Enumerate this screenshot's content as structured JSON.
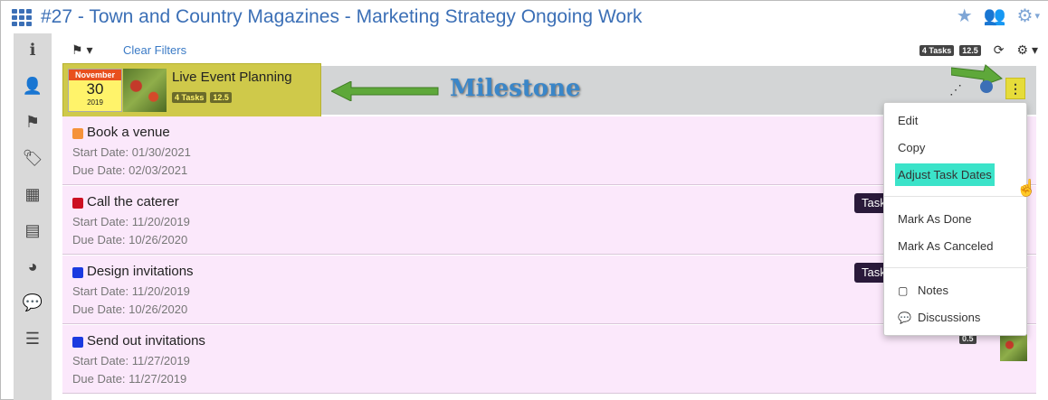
{
  "header": {
    "title": "#27 - Town and Country Magazines - Marketing Strategy Ongoing Work",
    "icons": [
      "apps-grid-icon",
      "star-icon",
      "users-icon",
      "gear-icon"
    ]
  },
  "sidebar": {
    "items": [
      {
        "name": "info-icon",
        "glyph": "ℹ"
      },
      {
        "name": "user-icon",
        "glyph": "👤"
      },
      {
        "name": "flag-icon",
        "glyph": "⚑"
      },
      {
        "name": "tags-icon",
        "glyph": "🏷"
      },
      {
        "name": "calendar-icon",
        "glyph": "▦"
      },
      {
        "name": "archive-icon",
        "glyph": "▤"
      },
      {
        "name": "pie-chart-icon",
        "glyph": "◕"
      },
      {
        "name": "comments-icon",
        "glyph": "💬"
      },
      {
        "name": "list-icon",
        "glyph": "☰"
      }
    ]
  },
  "toolbar": {
    "flag_glyph": "⚑ ▾",
    "clear_filters": "Clear Filters",
    "tasks_badge": "4 Tasks",
    "hours_badge": "12.5",
    "refresh_glyph": "⟳",
    "settings_glyph": "⚙ ▾"
  },
  "milestone": {
    "month": "November",
    "day": "30",
    "year": "2019",
    "title": "Live Event Planning",
    "tasks_badge": "4 Tasks",
    "hours_badge": "12.5",
    "annotation": "Milestone",
    "kebab_glyph": "⋮",
    "share_glyph": "⋰"
  },
  "tasks": [
    {
      "name": "Book a venue",
      "color": "#f5923a",
      "start": "Start Date: 01/30/2021",
      "due": "Due Date: 02/03/2021",
      "tag": "",
      "badge": ""
    },
    {
      "name": "Call the caterer",
      "color": "#cc1122",
      "start": "Start Date: 11/20/2019",
      "due": "Due Date: 10/26/2020",
      "tag": "Task",
      "badge": ""
    },
    {
      "name": "Design invitations",
      "color": "#1a3ae0",
      "start": "Start Date: 11/20/2019",
      "due": "Due Date: 10/26/2020",
      "tag": "Task",
      "badge": ""
    },
    {
      "name": "Send out invitations",
      "color": "#1a3ae0",
      "start": "Start Date: 11/27/2019",
      "due": "Due Date: 11/27/2019",
      "tag": "",
      "badge": "0.5"
    }
  ],
  "menu": {
    "edit": "Edit",
    "copy": "Copy",
    "adjust_dates": "Adjust Task Dates",
    "mark_done": "Mark As Done",
    "mark_canceled": "Mark As Canceled",
    "notes": "Notes",
    "discussions": "Discussions"
  }
}
